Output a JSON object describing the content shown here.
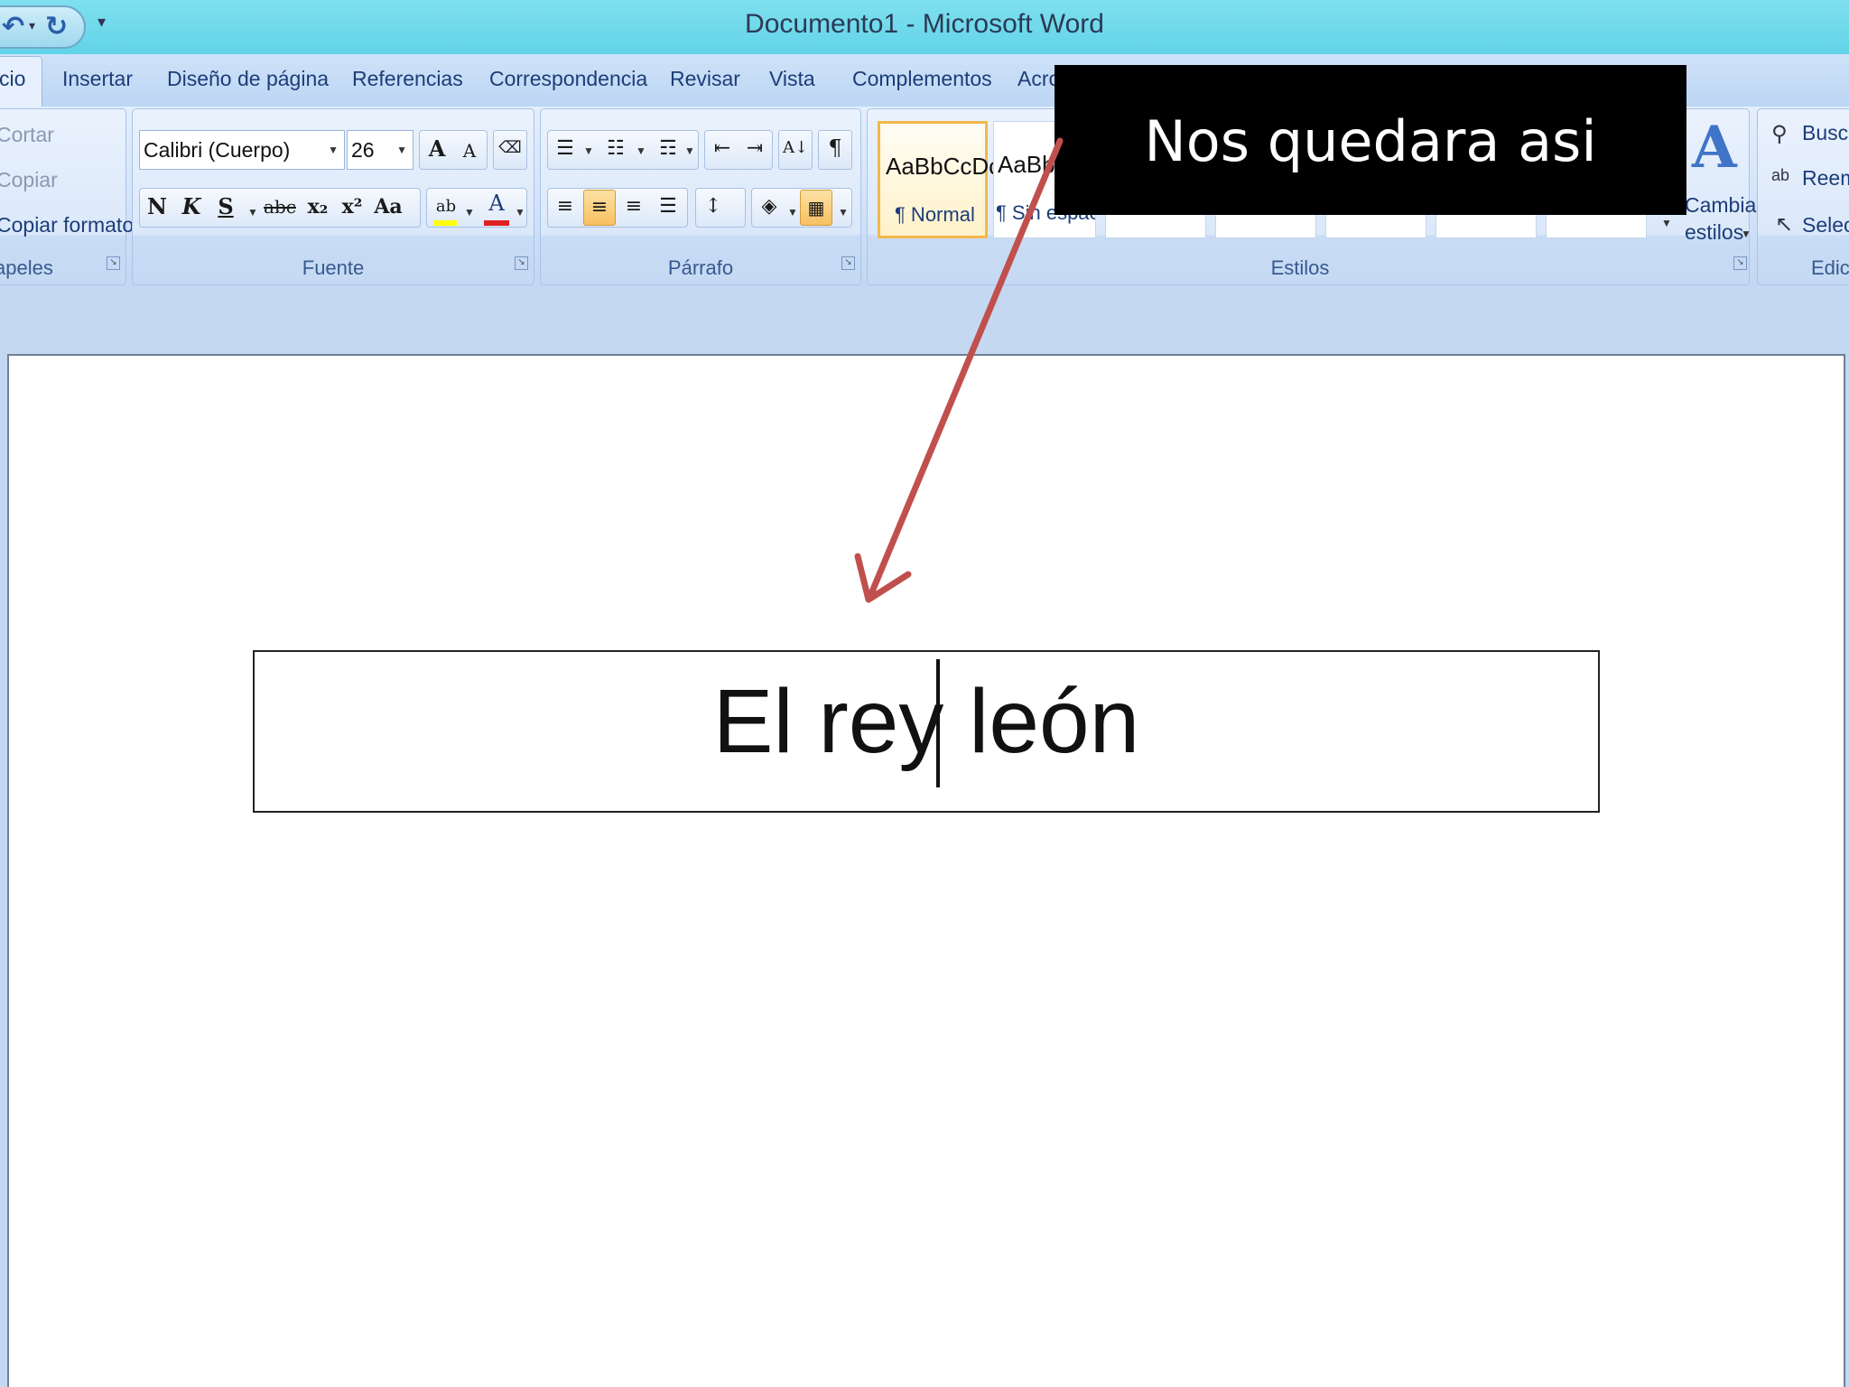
{
  "window": {
    "title": "Documento1 - Microsoft Word"
  },
  "tabs": [
    {
      "label": "cio"
    },
    {
      "label": "Insertar"
    },
    {
      "label": "Diseño de página"
    },
    {
      "label": "Referencias"
    },
    {
      "label": "Correspondencia"
    },
    {
      "label": "Revisar"
    },
    {
      "label": "Vista"
    },
    {
      "label": "Complementos"
    },
    {
      "label": "Acro"
    }
  ],
  "clipboard": {
    "cut": "Cortar",
    "copy": "Copiar",
    "format_painter": "Copiar formato",
    "label": "apeles"
  },
  "font": {
    "family": "Calibri (Cuerpo)",
    "size": "26",
    "label": "Fuente",
    "bold": "N",
    "italic": "K",
    "underline": "S",
    "strike": "abc",
    "subscript": "x₂",
    "superscript": "x²",
    "case": "Aa",
    "grow": "A",
    "shrink": "A",
    "highlight": "ab",
    "color_letter": "A"
  },
  "paragraph": {
    "label": "Párrafo",
    "pilcrow": "¶",
    "sort": "A↓"
  },
  "styles": {
    "label": "Estilos",
    "cards": [
      {
        "sample": "AaBbCcDc",
        "name": "¶ Normal"
      },
      {
        "sample": "AaBb",
        "name": "¶ Sin espaci"
      }
    ],
    "change_line1": "Cambiar",
    "change_line2": "estilos"
  },
  "editing": {
    "find": "Busc",
    "replace": "Reem",
    "select": "Selec",
    "label": "Edic"
  },
  "document": {
    "text_before_caret": "El rey",
    "text_after_caret": "león"
  },
  "annotation": {
    "text": "Nos quedara asi",
    "arrow_color": "#c0504d"
  },
  "colors": {
    "title_bar": "#62d3e8",
    "ribbon": "#d3e3f9",
    "font_color": "#e02020",
    "highlight": "#ffff00"
  },
  "icons": [
    "undo-icon",
    "redo-icon",
    "change-styles-icon",
    "find-icon",
    "replace-icon",
    "select-icon"
  ]
}
